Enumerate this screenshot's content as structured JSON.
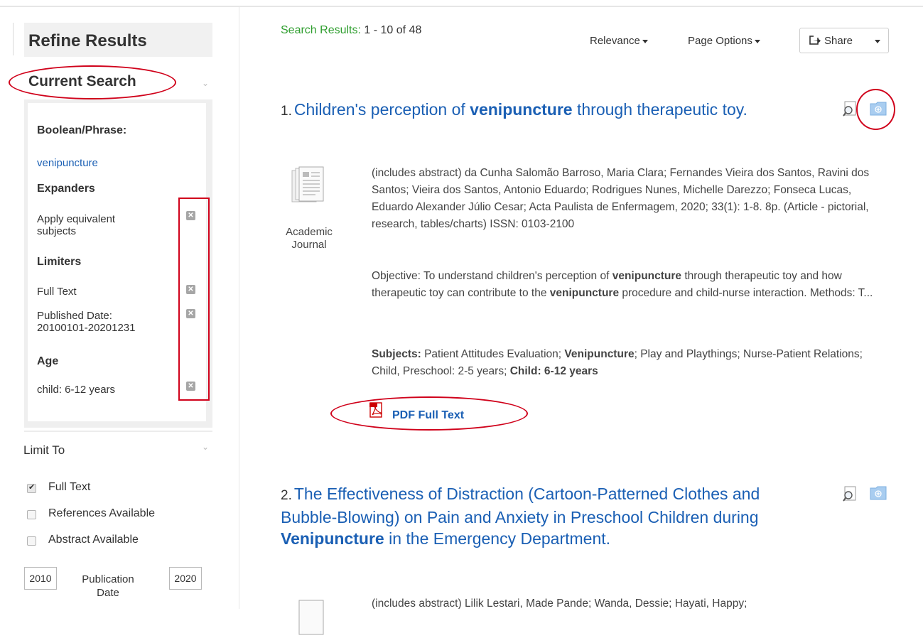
{
  "sidebar": {
    "refine_title": "Refine Results",
    "current_search": {
      "title": "Current Search",
      "boolean_label": "Boolean/Phrase:",
      "boolean_value": "venipuncture",
      "expanders_label": "Expanders",
      "expander_item": "Apply equivalent subjects",
      "limiters_label": "Limiters",
      "limiter_full_text": "Full Text",
      "limiter_published": "Published Date: 20100101-20201231",
      "age_label": "Age",
      "age_value": "child: 6-12 years"
    },
    "limit_to": {
      "title": "Limit To",
      "options": [
        {
          "label": "Full Text",
          "checked": true
        },
        {
          "label": "References Available",
          "checked": false
        },
        {
          "label": "Abstract Available",
          "checked": false
        }
      ],
      "year_from": "2010",
      "year_to": "2020",
      "pub_date_label": "Publication Date"
    }
  },
  "main": {
    "search_results_label": "Search Results:",
    "search_results_count": "1 - 10 of 48",
    "sort_label": "Relevance",
    "page_options_label": "Page Options",
    "share_label": "Share",
    "results": [
      {
        "number": "1.",
        "title_pre": "Children's perception of ",
        "title_bold": "venipuncture",
        "title_post": " through therapeutic toy.",
        "doc_type": "Academic Journal",
        "citation": "(includes abstract) da Cunha Salomão Barroso, Maria Clara; Fernandes Vieira dos Santos, Ravini dos Santos; Vieira dos Santos, Antonio Eduardo; Rodrigues Nunes, Michelle Darezzo; Fonseca Lucas, Eduardo Alexander Júlio Cesar; Acta Paulista de Enfermagem, 2020; 33(1): 1-8. 8p. (Article - pictorial, research, tables/charts) ISSN: 0103-2100",
        "abstract_1": "Objective: To understand children's perception of ",
        "abstract_b1": "venipuncture",
        "abstract_2": " through therapeutic toy and how therapeutic toy can contribute to the ",
        "abstract_b2": "venipuncture",
        "abstract_3": " procedure and child-nurse interaction. Methods: T...",
        "subjects_label": "Subjects:",
        "subjects_1": " Patient Attitudes Evaluation; ",
        "subjects_b1": "Venipuncture",
        "subjects_2": "; Play and Playthings; Nurse-Patient Relations; Child, Preschool: 2-5 years; ",
        "subjects_b2": "Child: 6-12 years",
        "pdf_label": "PDF Full Text"
      },
      {
        "number": "2.",
        "title_pre": "The Effectiveness of Distraction (Cartoon-Patterned Clothes and Bubble-Blowing) on Pain and Anxiety in Preschool Children during ",
        "title_bold": "Venipuncture",
        "title_post": " in the Emergency Department.",
        "citation": "(includes abstract) Lilik Lestari, Made Pande; Wanda, Dessie; Hayati, Happy;"
      }
    ]
  },
  "colors": {
    "link": "#1a5fb4",
    "results_label": "#2f9e2f",
    "annotation": "#d0021b"
  }
}
